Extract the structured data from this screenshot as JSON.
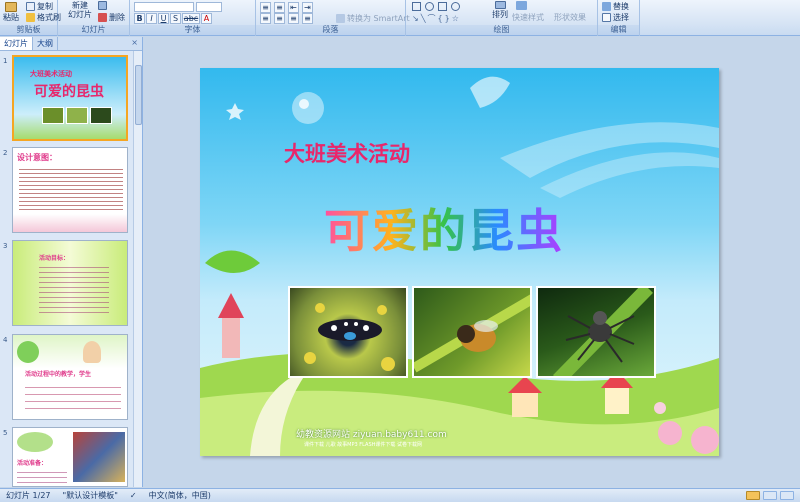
{
  "ribbon": {
    "groups": {
      "clipboard": "剪贴板",
      "slides": "幻灯片",
      "font": "字体",
      "paragraph": "段落",
      "drawing": "绘图",
      "editing": "编辑"
    },
    "buttons": {
      "paste": "粘贴",
      "copy": "复制",
      "format_painter": "格式刷",
      "new_slide": "新建",
      "new_slide_2": "幻灯片",
      "delete": "删除",
      "smartart": "转换为 SmartArt",
      "arrange": "排列",
      "quick_styles": "快速样式",
      "shape_effects": "形状效果",
      "replace": "替换",
      "select": "选择"
    },
    "format_letters": [
      "B",
      "I",
      "U",
      "S",
      "abc",
      "A"
    ]
  },
  "left_pane": {
    "tabs": [
      "幻灯片",
      "大纲"
    ],
    "close": "×",
    "slide_numbers": [
      "1",
      "2",
      "3",
      "4",
      "5"
    ],
    "thumb1_title": "大班美术活动",
    "thumb1_main": "可爱的昆虫",
    "thumb2_title": "设计意图：",
    "thumb3_title": "活动目标：",
    "thumb4_title": "活动过程中的教学，学生",
    "thumb5_title": "活动准备："
  },
  "slide": {
    "subtitle": "大班美术活动",
    "title": "可爱的昆虫",
    "website": "幼教资源网站  ziyuan.baby611.com",
    "links": "课件下载  儿歌  故事MP3  FLASH课件下载  试卷下载网"
  },
  "status": {
    "slide_count": "幻灯片 1/27",
    "theme": "\"默认设计模板\"",
    "language": "中文(简体，中国)"
  },
  "colors": {
    "accent": "#f5a623",
    "title_subtitle": "#e8276b"
  }
}
